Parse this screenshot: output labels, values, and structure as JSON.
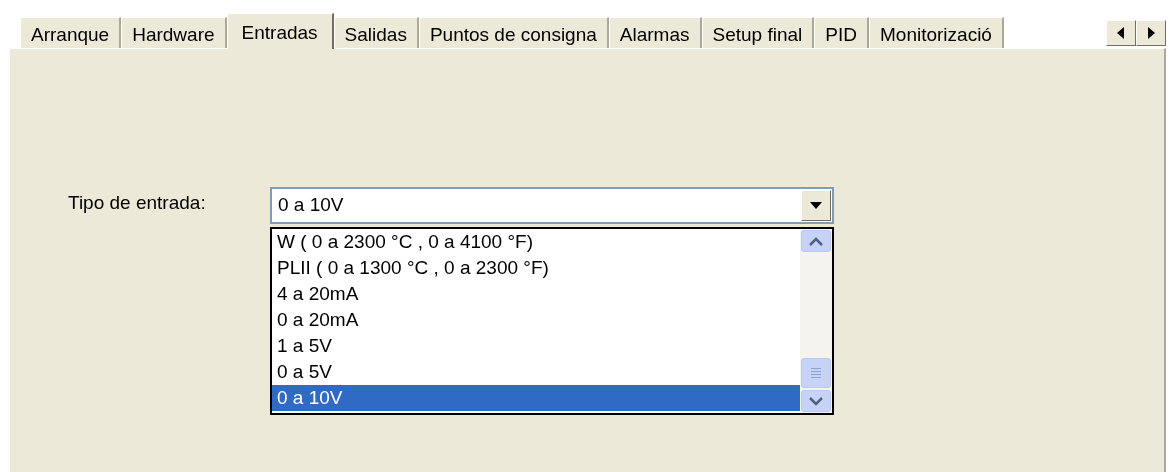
{
  "tabs": [
    {
      "label": "Arranque",
      "selected": false
    },
    {
      "label": "Hardware",
      "selected": false
    },
    {
      "label": "Entradas",
      "selected": true
    },
    {
      "label": "Salidas",
      "selected": false
    },
    {
      "label": "Puntos de consigna",
      "selected": false
    },
    {
      "label": "Alarmas",
      "selected": false
    },
    {
      "label": "Setup final",
      "selected": false
    },
    {
      "label": "PID",
      "selected": false
    },
    {
      "label": "Monitorizació",
      "selected": false
    }
  ],
  "input_type": {
    "label": "Tipo de entrada:",
    "value": "0 a 10V",
    "options": [
      {
        "label": "W  ( 0 a 2300 °C , 0 a 4100 °F)",
        "selected": false
      },
      {
        "label": "PLII  ( 0 a 1300 °C , 0 a 2300 °F)",
        "selected": false
      },
      {
        "label": "4 a 20mA",
        "selected": false
      },
      {
        "label": "0 a 20mA",
        "selected": false
      },
      {
        "label": "1 a 5V",
        "selected": false
      },
      {
        "label": "0 a 5V",
        "selected": false
      },
      {
        "label": "0 a 10V",
        "selected": true
      }
    ]
  }
}
